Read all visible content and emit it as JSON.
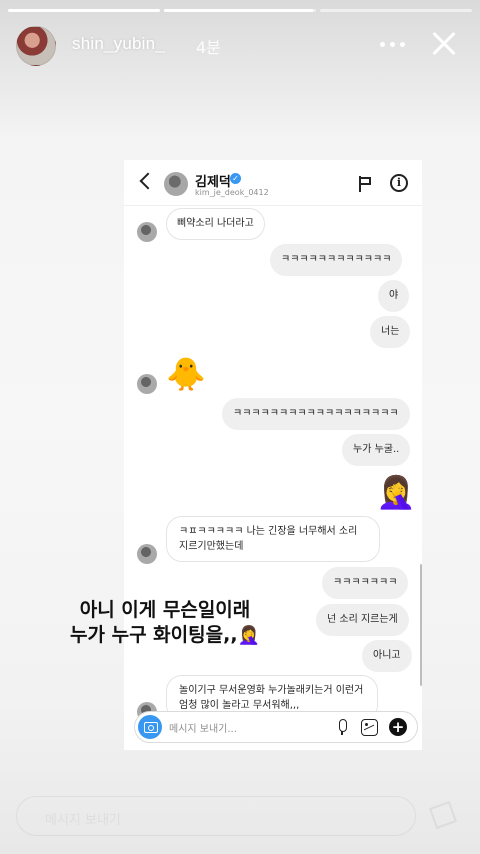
{
  "story": {
    "progress": [
      {
        "state": "complete",
        "fill": 1
      },
      {
        "state": "active",
        "fill": 0.98
      },
      {
        "state": "pending",
        "fill": 0
      }
    ],
    "header": {
      "username": "shin_yubin_",
      "time_ago": "4분",
      "more_icon": "more-horizontal-icon",
      "close_icon": "close-icon"
    },
    "caption": {
      "line1": "아니 이게 무슨일이래",
      "line2": "누가 누구 화이팅을,,",
      "line2_emoji": "🤦‍♀️"
    },
    "reply_placeholder": "메시지 보내기",
    "send_icon": "paper-plane-icon"
  },
  "dm": {
    "header": {
      "back_icon": "chevron-left-icon",
      "name": "김제덕",
      "verified_icon": "verified-badge-icon",
      "handle": "kim_je_deok_0412",
      "flag_icon": "flag-icon",
      "info_icon": "info-icon"
    },
    "messages": [
      {
        "from": "them",
        "text": "삐약소리 나더라고"
      },
      {
        "from": "me",
        "text": "ㅋㅋㅋㅋㅋㅋㅋㅋㅋㅋㅋㅋ"
      },
      {
        "from": "me",
        "text": "야"
      },
      {
        "from": "me",
        "text": "너는"
      },
      {
        "from": "them",
        "emoji": "🐥"
      },
      {
        "from": "me",
        "text": "ㅋㅋㅋㅋㅋㅋㅋㅋㅋㅋㅋㅋㅋㅋㅋㅋㅋㅋ"
      },
      {
        "from": "me",
        "text": "누가 누굴.."
      },
      {
        "from": "me",
        "emoji": "🤦‍♀️"
      },
      {
        "from": "them",
        "text": "ㅋㅍㅋㅋㅋㅋㅋ 나는 긴장을 너무해서 소리 지르기만했는데"
      },
      {
        "from": "me",
        "text": "ㅋㅋㅋㅋㅋㅋㅋ"
      },
      {
        "from": "me",
        "text": "넌 소리 지르는게"
      },
      {
        "from": "me",
        "text": "아니고"
      },
      {
        "from": "them",
        "text": "놀이기구 무서운영화 누가놀래키는거 이런거 엄청 많이 놀라고 무서워해,,,"
      }
    ],
    "composer": {
      "camera_icon": "camera-icon",
      "placeholder": "메시지 보내기...",
      "mic_icon": "microphone-icon",
      "gallery_icon": "gallery-icon",
      "plus_icon": "plus-icon",
      "plus_glyph": "+"
    }
  }
}
